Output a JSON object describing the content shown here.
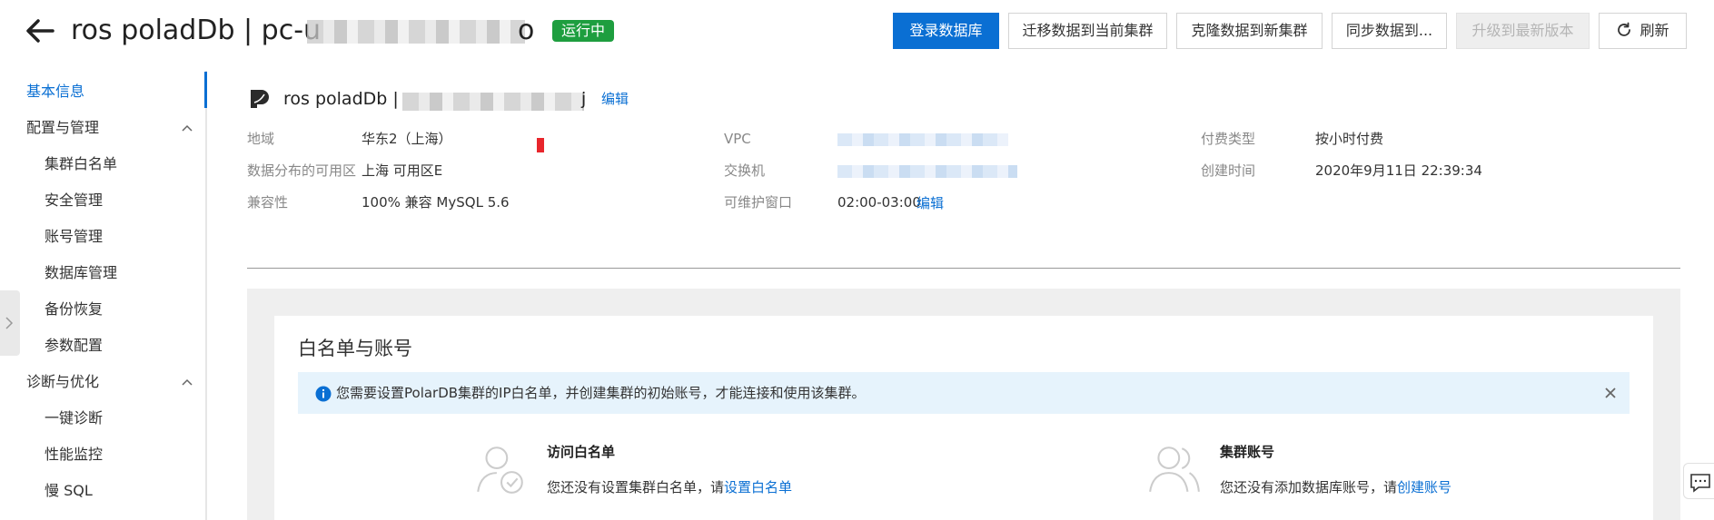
{
  "header": {
    "title_visible": "ros poladDb | pc-u",
    "title_tail": "o",
    "status": "运行中",
    "buttons": {
      "login_db": "登录数据库",
      "migrate": "迁移数据到当前集群",
      "clone": "克隆数据到新集群",
      "sync": "同步数据到...",
      "upgrade": "升级到最新版本",
      "refresh": "刷新"
    }
  },
  "sidebar": {
    "basic_info": "基本信息",
    "config_mgmt": "配置与管理",
    "config_items": [
      "集群白名单",
      "安全管理",
      "账号管理",
      "数据库管理",
      "备份恢复",
      "参数配置"
    ],
    "diag_opt": "诊断与优化",
    "diag_items": [
      "一键诊断",
      "性能监控",
      "慢 SQL"
    ]
  },
  "instance": {
    "name": "ros poladDb |",
    "name_tail": "j",
    "edit": "编辑",
    "fields": {
      "region_label": "地域",
      "region_value": "华东2（上海）",
      "zone_label": "数据分布的可用区",
      "zone_value": "上海 可用区E",
      "compat_label": "兼容性",
      "compat_value": "100% 兼容 MySQL 5.6",
      "vpc_label": "VPC",
      "switch_label": "交换机",
      "maint_label": "可维护窗口",
      "maint_value": "02:00-03:00",
      "maint_edit": "编辑",
      "pay_label": "付费类型",
      "pay_value": "按小时付费",
      "created_label": "创建时间",
      "created_value": "2020年9月11日 22:39:34"
    }
  },
  "whitelist_card": {
    "title": "白名单与账号",
    "notice": "您需要设置PolarDB集群的IP白名单，并创建集群的初始账号，才能连接和使用该集群。",
    "whitelist_title": "访问白名单",
    "whitelist_desc": "您还没有设置集群白名单，请",
    "whitelist_link": "设置白名单",
    "account_title": "集群账号",
    "account_desc": "您还没有添加数据库账号，请",
    "account_link": "创建账号"
  },
  "colors": {
    "primary": "#0a6fd3",
    "status_green": "#1e9e3f",
    "notice_bg": "#e6f3fc"
  }
}
